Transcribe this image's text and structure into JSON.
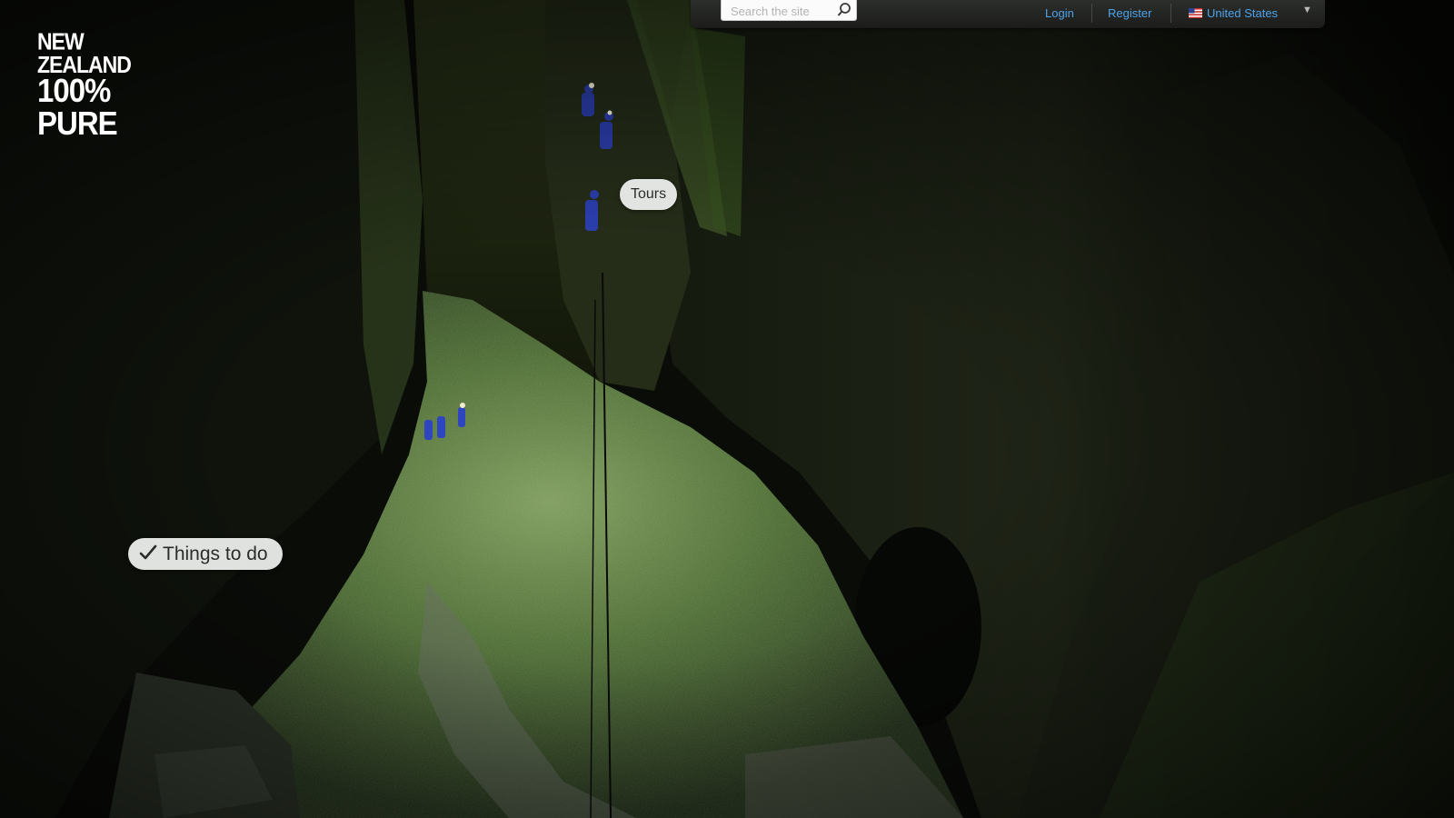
{
  "logo": {
    "line1": "NEW ZEALAND",
    "line2": "100% PURE"
  },
  "header": {
    "search": {
      "placeholder": "Search the site",
      "value": ""
    },
    "login_label": "Login",
    "register_label": "Register",
    "country": {
      "label": "United States",
      "flag_icon": "us-flag-icon"
    }
  },
  "hotspots": {
    "tours_label": "Tours",
    "things_to_do_label": "Things to do"
  },
  "colors": {
    "link": "#4da3ea",
    "topbar": "#232422",
    "pill_bg": "#f0f2f0",
    "moss": "#4f6c33"
  }
}
